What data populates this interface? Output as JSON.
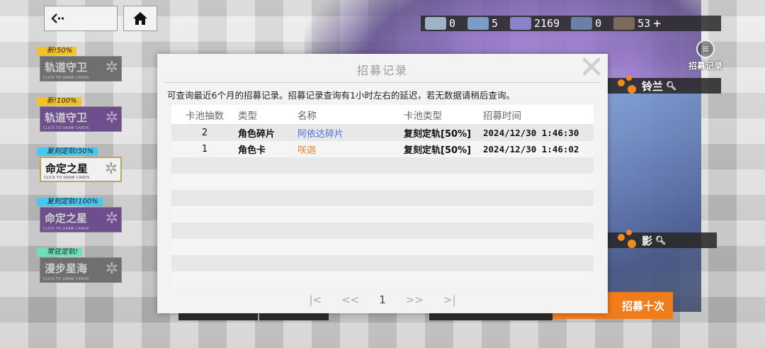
{
  "nav": {
    "back_icon": "back-arrow-icon",
    "home_icon": "home-icon"
  },
  "banners": [
    {
      "tag": "新!50%",
      "name": "轨道守卫",
      "sub": "CLICK TO DRAW CARDS",
      "tag_color": "#f5c12a",
      "style": "grey"
    },
    {
      "tag": "新!100%",
      "name": "轨道守卫",
      "sub": "CLICK TO DRAW CARDS",
      "tag_color": "#f5c12a",
      "style": "purple"
    },
    {
      "tag": "复刻定轨!50%",
      "name": "命定之星",
      "sub": "CLICK TO DRAW CARDS",
      "tag_color": "#48c6f0",
      "style": "active"
    },
    {
      "tag": "复刻定轨!100%",
      "name": "命定之星",
      "sub": "CLICK TO DRAW CARDS",
      "tag_color": "#48c6f0",
      "style": "purple"
    },
    {
      "tag": "常驻定轨!",
      "name": "漫步星海",
      "sub": "CLICK TO DRAW CARDS",
      "tag_color": "#6ee0b8",
      "style": "grey"
    }
  ],
  "resources": [
    {
      "icon": "ticket-icon",
      "value": "0"
    },
    {
      "icon": "star-shard-icon",
      "value": "5"
    },
    {
      "icon": "crystal-icon",
      "value": "2169"
    },
    {
      "icon": "key-icon",
      "value": "0"
    },
    {
      "icon": "character-avatar-icon",
      "value": "53"
    }
  ],
  "resource_plus": "+",
  "side": {
    "record_label": "招募记录",
    "char1": "铃兰",
    "char2": "影",
    "draw_ten": "招募十次"
  },
  "modal": {
    "title": "招募记录",
    "notice": "可查询最近6个月的招募记录。招募记录查询有1小时左右的延迟，若无数据请稍后查询。",
    "headers": [
      "卡池抽数",
      "类型",
      "名称",
      "卡池类型",
      "招募时间"
    ],
    "rows": [
      {
        "count": "2",
        "type": "角色碎片",
        "name": "阿依达碎片",
        "pool": "复刻定轨[50%]",
        "time": "2024/12/30 1:46:30",
        "name_color": "#4c6bd8"
      },
      {
        "count": "1",
        "type": "角色卡",
        "name": "咲迦",
        "pool": "复刻定轨[50%]",
        "time": "2024/12/30 1:46:02",
        "name_color": "#e9822b"
      }
    ],
    "empty_rows": 8,
    "pager": {
      "first": "|<",
      "prev": "<<",
      "page": "1",
      "next": ">>",
      "last": ">|"
    }
  }
}
